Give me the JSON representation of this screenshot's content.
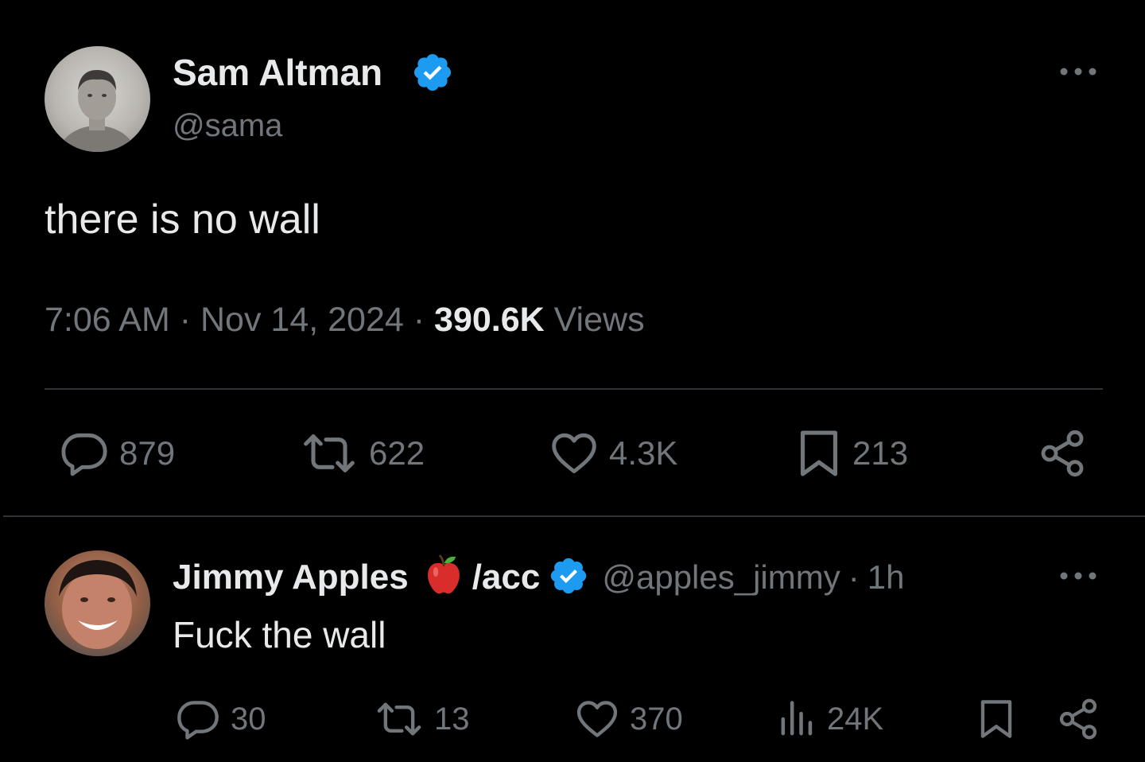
{
  "main_tweet": {
    "author": {
      "name": "Sam Altman",
      "handle": "@sama",
      "verified": true
    },
    "text": "there is no wall",
    "time": "7:06 AM",
    "separator": "·",
    "date": "Nov 14, 2024",
    "views_count": "390.6K",
    "views_label": "Views",
    "actions": {
      "reply_count": "879",
      "repost_count": "622",
      "like_count": "4.3K",
      "bookmark_count": "213"
    }
  },
  "reply_tweet": {
    "author": {
      "name": "Jimmy Apples",
      "name_suffix": "/acc",
      "handle": "@apples_jimmy",
      "verified": true
    },
    "separator": "·",
    "time_ago": "1h",
    "text": "Fuck the wall",
    "actions": {
      "reply_count": "30",
      "repost_count": "13",
      "like_count": "370",
      "views_count": "24K"
    }
  },
  "colors": {
    "background": "#000000",
    "primary_text": "#e7e9ea",
    "secondary_text": "#71767b",
    "divider": "#2f3336",
    "verified_blue": "#1d9bf0",
    "apple_red": "#d92d2b"
  },
  "icons": [
    "verified-badge-icon",
    "more-icon",
    "reply-icon",
    "repost-icon",
    "like-icon",
    "bookmark-icon",
    "share-icon",
    "views-icon",
    "red-apple-emoji-icon"
  ]
}
